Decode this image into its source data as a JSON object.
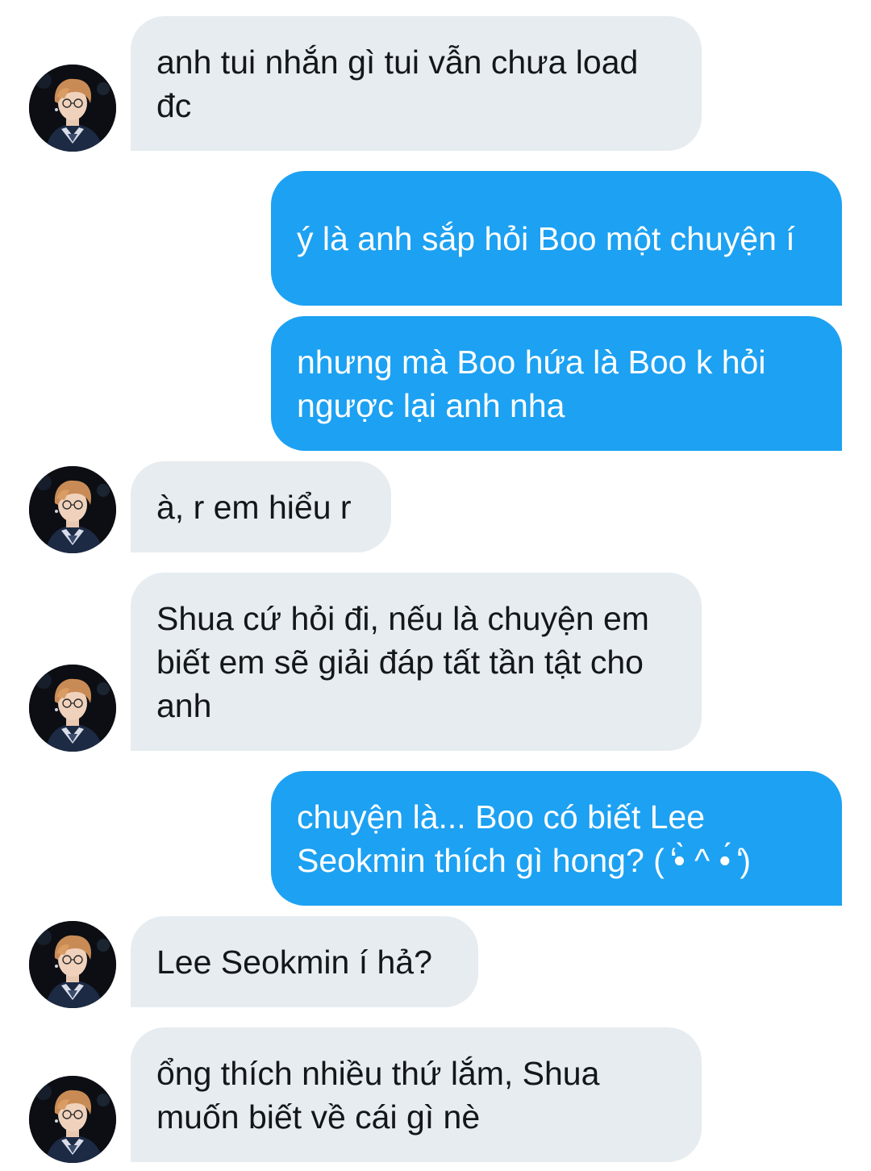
{
  "conversation": {
    "messages": [
      {
        "direction": "incoming",
        "text": "anh tui nhắn gì tui vẫn chưa load đc"
      },
      {
        "direction": "outgoing",
        "text": "ý là anh sắp hỏi Boo một chuyện í"
      },
      {
        "direction": "outgoing",
        "text": "nhưng mà Boo hứa là Boo k hỏi ngược lại anh nha"
      },
      {
        "direction": "incoming",
        "text": "à, r em hiểu r"
      },
      {
        "direction": "incoming",
        "text": "Shua cứ hỏi đi, nếu là chuyện em biết em sẽ giải đáp tất tần tật cho anh"
      },
      {
        "direction": "outgoing",
        "text": "chuyện là... Boo có biết Lee Seokmin thích gì hong? ( ̒•̀ ^ •́ ̒)"
      },
      {
        "direction": "incoming",
        "text": "Lee Seokmin í hả?"
      },
      {
        "direction": "incoming",
        "text": "ổng thích nhiều thứ lắm, Shua muốn biết về cái gì nè"
      }
    ]
  },
  "colors": {
    "incoming_bubble": "#e6ecf0",
    "incoming_text": "#14171a",
    "outgoing_bubble": "#1da1f2",
    "outgoing_text": "#ffffff",
    "background": "#ffffff"
  },
  "icons": {
    "avatar": "contact-avatar-photo"
  }
}
